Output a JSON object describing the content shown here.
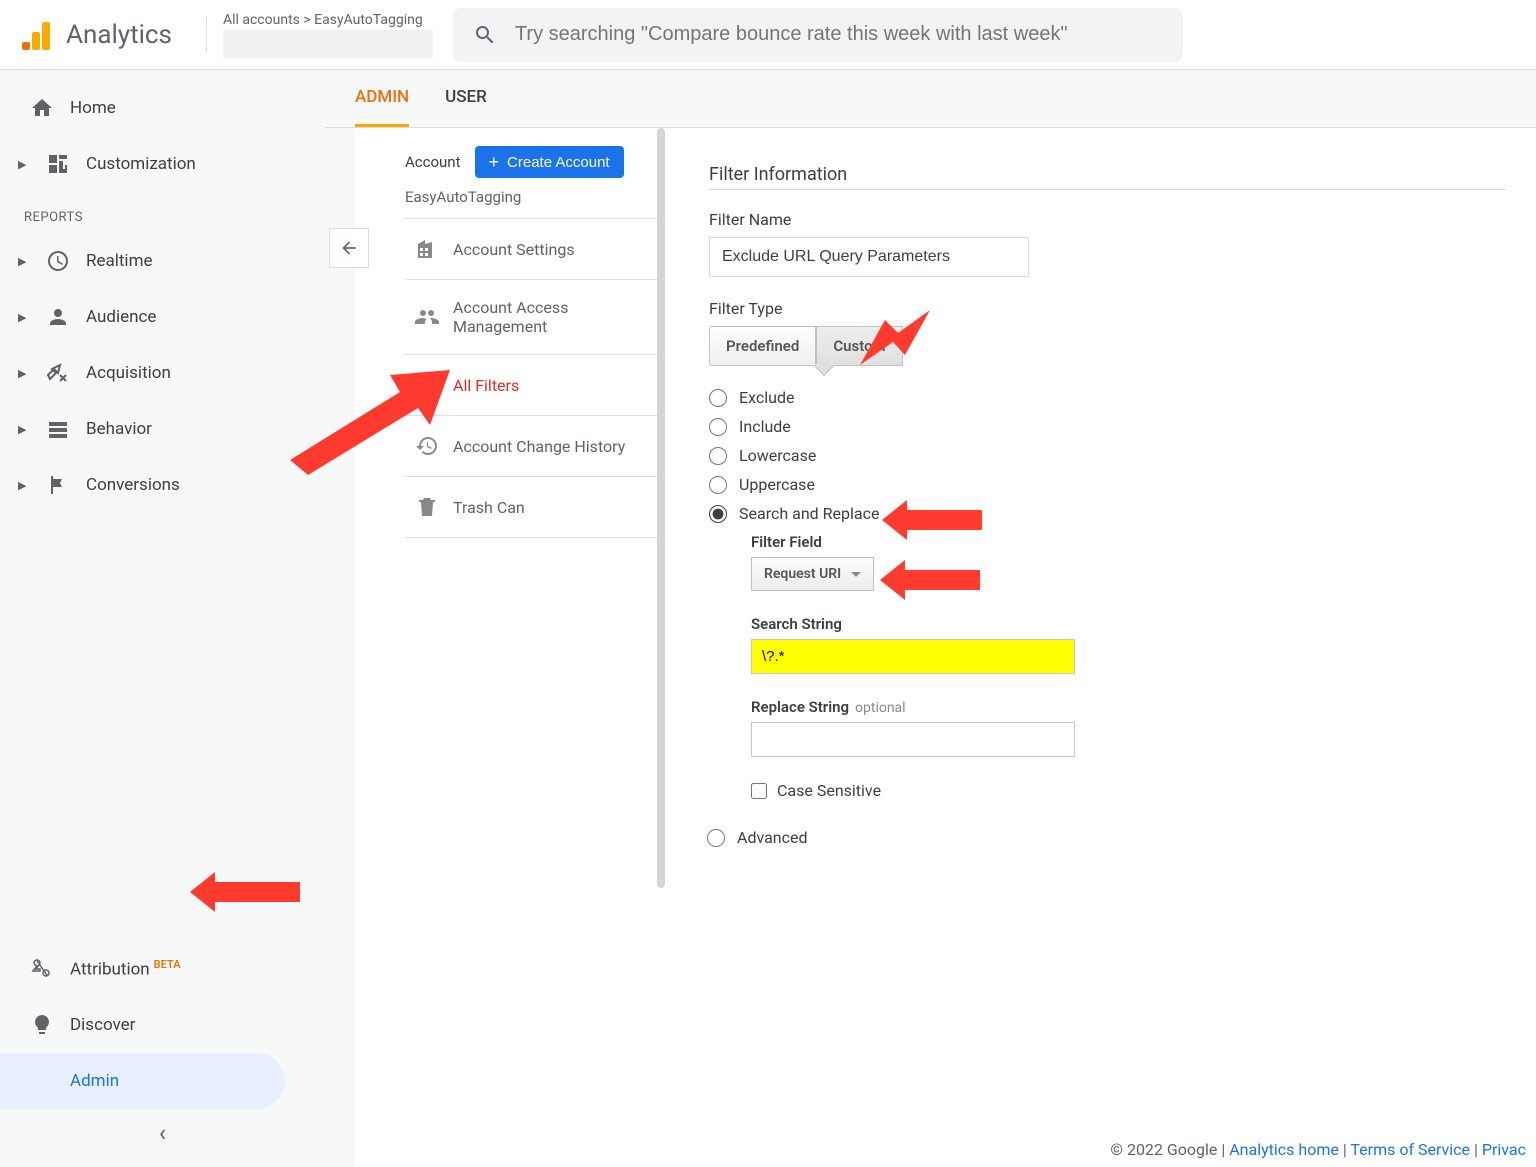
{
  "header": {
    "logo_text": "Analytics",
    "breadcrumb": "All accounts > EasyAutoTagging",
    "search_placeholder": "Try searching \"Compare bounce rate this week with last week\""
  },
  "sidebar": {
    "home": "Home",
    "customization": "Customization",
    "reports_heading": "REPORTS",
    "realtime": "Realtime",
    "audience": "Audience",
    "acquisition": "Acquisition",
    "behavior": "Behavior",
    "conversions": "Conversions",
    "attribution": "Attribution",
    "attribution_badge": "BETA",
    "discover": "Discover",
    "admin": "Admin"
  },
  "tabs": {
    "admin": "ADMIN",
    "user": "USER"
  },
  "account_col": {
    "label": "Account",
    "create_button": "Create Account",
    "account_name": "EasyAutoTagging",
    "items": {
      "settings": "Account Settings",
      "access": "Account Access Management",
      "filters": "All Filters",
      "history": "Account Change History",
      "trash": "Trash Can"
    }
  },
  "filter_form": {
    "section_title": "Filter Information",
    "name_label": "Filter Name",
    "name_value": "Exclude URL Query Parameters",
    "type_label": "Filter Type",
    "type_predefined": "Predefined",
    "type_custom": "Custom",
    "radio": {
      "exclude": "Exclude",
      "include": "Include",
      "lowercase": "Lowercase",
      "uppercase": "Uppercase",
      "search_replace": "Search and Replace",
      "advanced": "Advanced"
    },
    "filter_field_label": "Filter Field",
    "filter_field_value": "Request URI",
    "search_string_label": "Search String",
    "search_string_value": "\\?.*",
    "replace_string_label": "Replace String",
    "replace_optional": "optional",
    "case_sensitive": "Case Sensitive"
  },
  "footer": {
    "copyright": "© 2022 Google | ",
    "analytics_home": "Analytics home",
    "terms": "Terms of Service",
    "privacy": "Privac"
  }
}
